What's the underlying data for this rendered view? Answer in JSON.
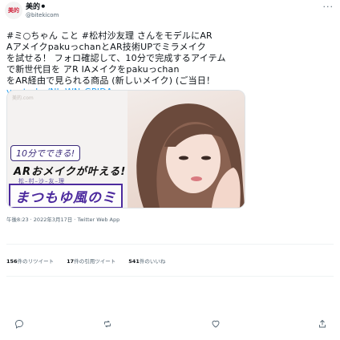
{
  "header": {
    "avatar_text": "美的",
    "display_name": "美的⚫",
    "handle": "@bitekicom",
    "more_icon": "more-dots-icon"
  },
  "tweet": {
    "text": "#ミ○ちゃん こと #松村沙友理 さんをモデルにAR\nAアメイクpakuっchanとAR技術UPでミラメイク\nを試せる！ フォロ確認して、10分で完成するアイテム\nで新世代目を アR IAメイクをpakuっchan\nをAR経由で見られる商品 (新しいメイク) (ご当日！\n",
    "link": "youtu.be/Nk-WNrGPIDA"
  },
  "media": {
    "logo": "美的.com",
    "badge": "10分でできる!",
    "caption1": "ARおメイクが叶える!",
    "caption2": "松–村–沙–友–理",
    "caption_main": "まつもゆ風のミ"
  },
  "meta": {
    "timestamp": "午後8:23 · 2022年3月17日 · Twitter Web App"
  },
  "stats": {
    "retweets_count": "156",
    "retweets_label": "件のリツイート",
    "quotes_count": "17",
    "quotes_label": "件の引用ツイート",
    "likes_count": "541",
    "likes_label": "件のいいね"
  },
  "actions": {
    "reply_icon": "reply-icon",
    "retweet_icon": "retweet-icon",
    "like_icon": "heart-icon",
    "share_icon": "share-icon"
  },
  "colors": {
    "link": "#1d9bf0",
    "accent_purple": "#4c2a9e",
    "muted": "#536471"
  }
}
